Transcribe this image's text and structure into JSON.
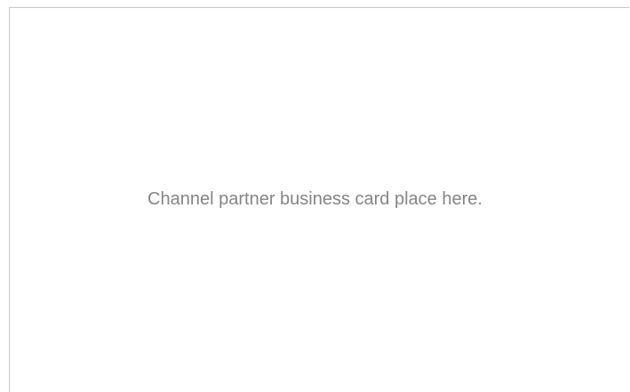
{
  "card": {
    "placeholder": "Channel partner business card place here."
  },
  "colors": {
    "border": "#c8c8c8",
    "text": "#858585",
    "background": "#ffffff"
  }
}
